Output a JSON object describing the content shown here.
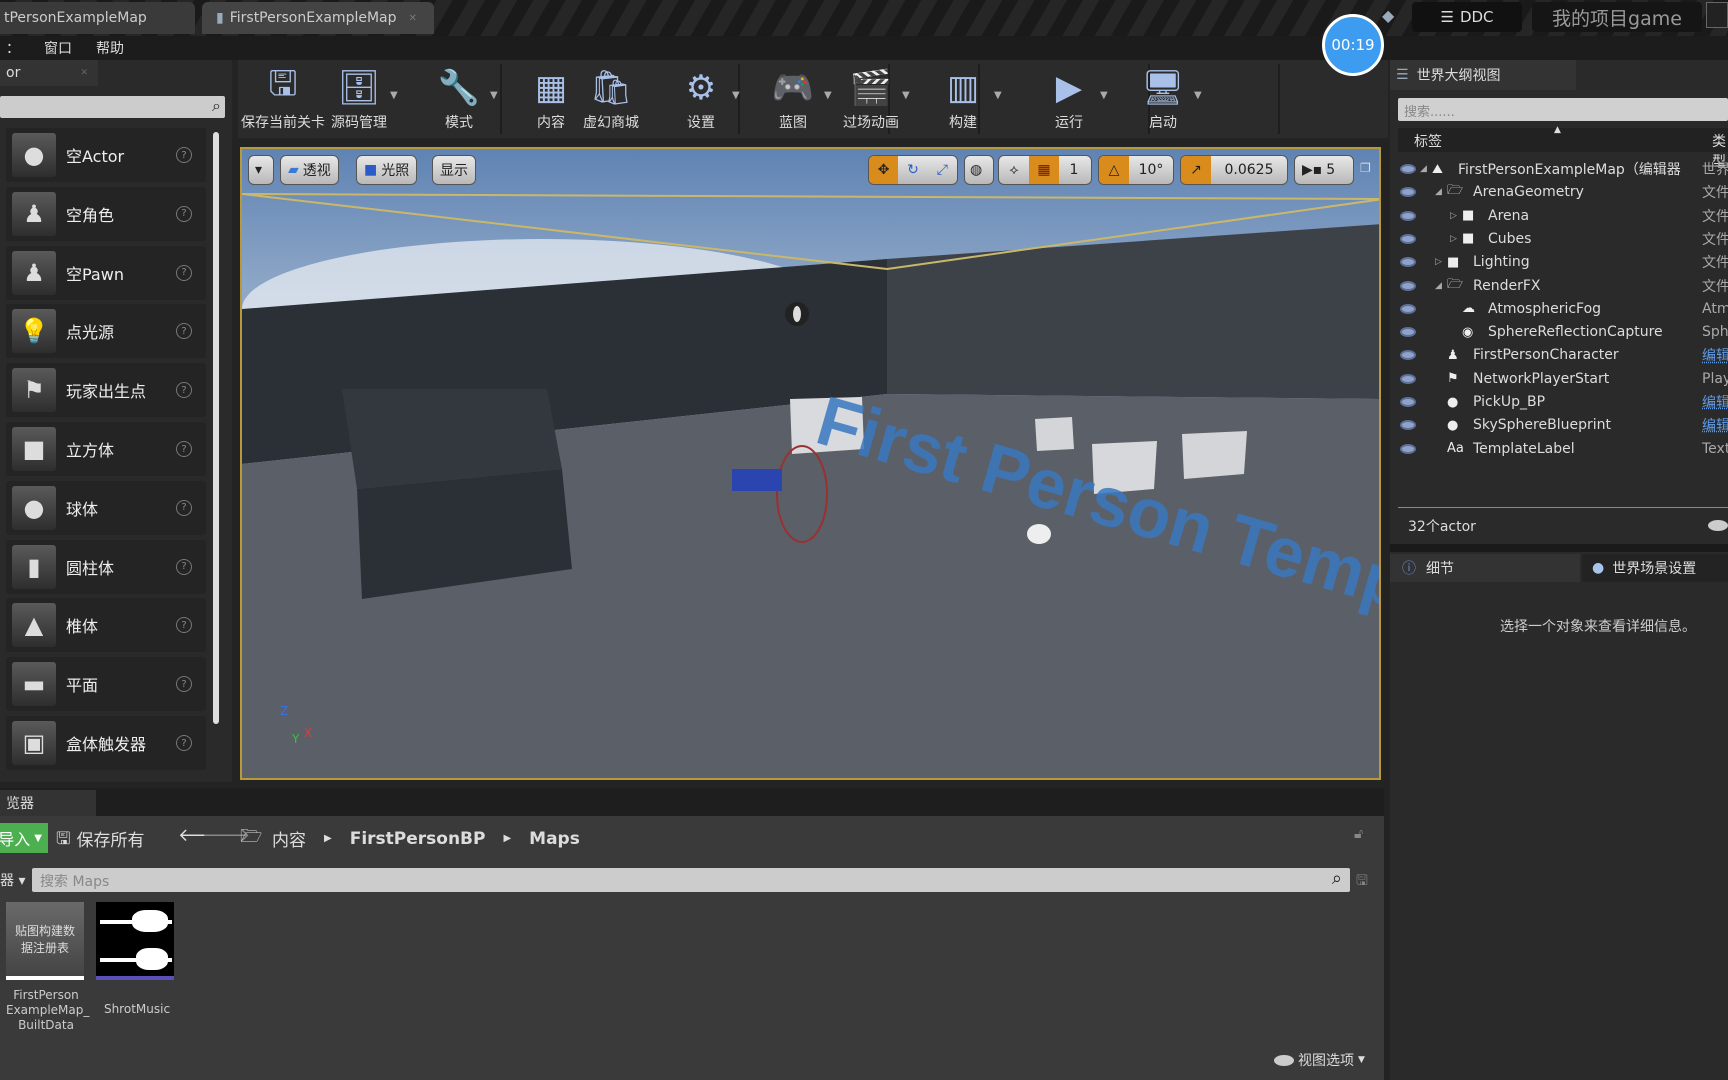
{
  "tabs": [
    {
      "label": "tPersonExampleMap"
    },
    {
      "label": "FirstPersonExampleMap"
    }
  ],
  "title_bar": {
    "ddc_label": "DDC",
    "project_name": "我的项目game",
    "timer": "00:19"
  },
  "menu": {
    "items": [
      "：",
      "窗口",
      "帮助"
    ]
  },
  "place_panel": {
    "tab_label": "or",
    "items": [
      {
        "label": "空Actor"
      },
      {
        "label": "空角色"
      },
      {
        "label": "空Pawn"
      },
      {
        "label": "点光源"
      },
      {
        "label": "玩家出生点"
      },
      {
        "label": "立方体"
      },
      {
        "label": "球体"
      },
      {
        "label": "圆柱体"
      },
      {
        "label": "椎体"
      },
      {
        "label": "平面"
      },
      {
        "label": "盒体触发器"
      }
    ]
  },
  "toolbar": {
    "buttons": [
      {
        "label": "保存当前关卡",
        "icon": "floppy-icon"
      },
      {
        "label": "源码管理",
        "icon": "source-control-icon"
      },
      {
        "label": "模式",
        "icon": "modes-icon"
      },
      {
        "label": "内容",
        "icon": "content-icon"
      },
      {
        "label": "虚幻商城",
        "icon": "marketplace-icon"
      },
      {
        "label": "设置",
        "icon": "settings-icon"
      },
      {
        "label": "蓝图",
        "icon": "blueprint-icon"
      },
      {
        "label": "过场动画",
        "icon": "cinematics-icon"
      },
      {
        "label": "构建",
        "icon": "build-icon"
      },
      {
        "label": "运行",
        "icon": "play-icon"
      },
      {
        "label": "启动",
        "icon": "launch-icon"
      }
    ]
  },
  "viewport": {
    "perspective": "透视",
    "lighting": "光照",
    "show": "显示",
    "grid_snap": "1",
    "rotation_snap": "10°",
    "scale_snap": "0.0625",
    "camera_speed": "5",
    "axis": {
      "z": "Z",
      "x": "X",
      "y": "Y"
    },
    "floor_text": "First Person Template"
  },
  "outliner": {
    "tab_label": "世界大纲视图",
    "search_placeholder": "搜索......",
    "col_label": "标签",
    "col_type": "类型",
    "rows": [
      {
        "label": "FirstPersonExampleMap（编辑器",
        "type": "世界",
        "indent": 0,
        "icon": "map-icon"
      },
      {
        "label": "ArenaGeometry",
        "type": "文件",
        "indent": 1,
        "icon": "folder-open-icon"
      },
      {
        "label": "Arena",
        "type": "文件",
        "indent": 2,
        "icon": "folder-icon"
      },
      {
        "label": "Cubes",
        "type": "文件",
        "indent": 2,
        "icon": "folder-icon"
      },
      {
        "label": "Lighting",
        "type": "文件",
        "indent": 1,
        "icon": "folder-icon"
      },
      {
        "label": "RenderFX",
        "type": "文件",
        "indent": 1,
        "icon": "folder-open-icon"
      },
      {
        "label": "AtmosphericFog",
        "type": "Atm",
        "indent": 2,
        "icon": "fog-icon"
      },
      {
        "label": "SphereReflectionCapture",
        "type": "Sph",
        "indent": 2,
        "icon": "reflection-icon"
      },
      {
        "label": "FirstPersonCharacter",
        "type": "编辑",
        "indent": 1,
        "icon": "character-icon",
        "link": true
      },
      {
        "label": "NetworkPlayerStart",
        "type": "Play",
        "indent": 1,
        "icon": "player-start-icon"
      },
      {
        "label": "PickUp_BP",
        "type": "编辑",
        "indent": 1,
        "icon": "sphere-icon",
        "link": true
      },
      {
        "label": "SkySphereBlueprint",
        "type": "编辑",
        "indent": 1,
        "icon": "sphere-icon",
        "link": true
      },
      {
        "label": "TemplateLabel",
        "type": "Text",
        "indent": 1,
        "icon": "text-icon"
      }
    ],
    "actor_count": "32个actor"
  },
  "details": {
    "tab_label": "细节",
    "world_settings_label": "世界场景设置",
    "empty_message": "选择一个对象来查看详细信息。"
  },
  "content_browser": {
    "tab_label": "览器",
    "import_label": "导入",
    "save_all_label": "保存所有",
    "breadcrumb": [
      "内容",
      "FirstPersonBP",
      "Maps"
    ],
    "filter_label": "器",
    "search_placeholder": "搜索 Maps",
    "assets": [
      {
        "thumb_text": "贴图构建数据注册表",
        "name": "FirstPerson ExampleMap_ BuiltData"
      },
      {
        "thumb_text": "",
        "name": "ShrotMusic"
      }
    ],
    "view_options": "视图选项"
  }
}
